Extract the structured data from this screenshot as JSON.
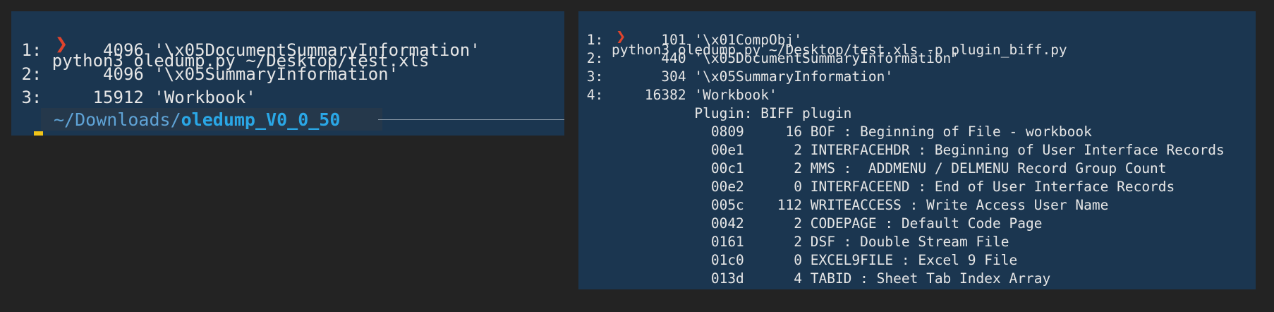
{
  "colors": {
    "page_background": "#232323",
    "terminal_background": "#1b3650",
    "text": "#e6e6e6",
    "prompt_arrow": "#e0442d",
    "path_dim": "#5fa3d6",
    "path_highlight": "#2aa7e6",
    "cursor": "#f0c419"
  },
  "left_terminal": {
    "prompt_symbol": "❯",
    "command": "python3 oledump.py ~/Desktop/test.xls",
    "output": [
      " 1:      4096 '\\x05DocumentSummaryInformation'",
      " 2:      4096 '\\x05SummaryInformation'",
      " 3:     15912 'Workbook'"
    ],
    "cwd": {
      "home": "~/",
      "dir": "Downloads/",
      "leaf": "oledump_V0_0_50"
    }
  },
  "right_terminal": {
    "prompt_symbol": "❯",
    "command": "python3 oledump.py ~/Desktop/test.xls -p plugin_biff.py",
    "output": [
      " 1:       101 '\\x01CompObj'",
      " 2:       440 '\\x05DocumentSummaryInformation'",
      " 3:       304 '\\x05SummaryInformation'",
      " 4:     16382 'Workbook'",
      "              Plugin: BIFF plugin",
      "                0809     16 BOF : Beginning of File - workbook",
      "                00e1      2 INTERFACEHDR : Beginning of User Interface Records",
      "                00c1      2 MMS :  ADDMENU / DELMENU Record Group Count",
      "                00e2      0 INTERFACEEND : End of User Interface Records",
      "                005c    112 WRITEACCESS : Write Access User Name",
      "                0042      2 CODEPAGE : Default Code Page",
      "                0161      2 DSF : Double Stream File",
      "                01c0      0 EXCEL9FILE : Excel 9 File",
      "                013d      4 TABID : Sheet Tab Index Array"
    ]
  }
}
